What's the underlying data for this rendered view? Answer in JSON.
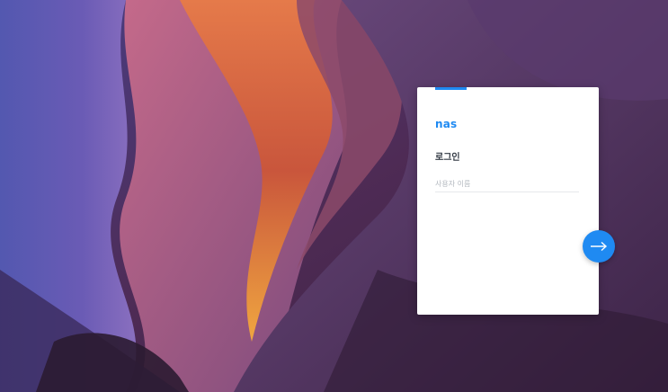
{
  "login": {
    "app_name": "nas",
    "title": "로그인",
    "username_placeholder": "사용자 이름",
    "username_value": ""
  },
  "icons": {
    "next": "arrow-right-icon"
  },
  "colors": {
    "accent": "#1f8af2",
    "card_background": "#ffffff",
    "title_text": "#333a44",
    "placeholder_text": "#b3b8bf"
  }
}
